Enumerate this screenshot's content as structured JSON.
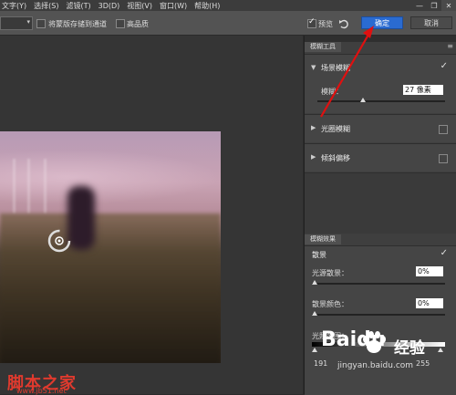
{
  "menu": {
    "items": [
      "文字(Y)",
      "选择(S)",
      "滤镜(T)",
      "3D(D)",
      "视图(V)",
      "窗口(W)",
      "帮助(H)"
    ]
  },
  "window": {
    "minimize": "—",
    "restore": "❐",
    "close": "✕"
  },
  "options": {
    "select_value": "",
    "save_mask_label": "将蒙版存储到通道",
    "high_quality_label": "高品质",
    "preview_label": "预览",
    "preview_checked": true,
    "ok_label": "确定",
    "cancel_label": "取消"
  },
  "panel": {
    "tab_label": "模糊工具",
    "field_blur": {
      "title": "场景模糊",
      "checked": true,
      "blur_label": "模糊：",
      "blur_value": "27 像素"
    },
    "iris_blur": {
      "title": "光圈模糊",
      "checked": false
    },
    "tilt_shift": {
      "title": "倾斜偏移",
      "checked": false
    },
    "effects_tab_label": "模糊效果",
    "bokeh": {
      "title": "散景",
      "checked": true,
      "light_bokeh_label": "光源散景：",
      "light_bokeh_value": "0%",
      "bokeh_color_label": "散景颜色：",
      "bokeh_color_value": "0%",
      "light_range_label": "光照范围：",
      "range_low": "191",
      "range_high": "255"
    }
  },
  "watermarks": {
    "site_cn": "脚本之家",
    "site_url": "www.jb51.net",
    "baidu_logo": "Baidu",
    "baidu_cn": "经验",
    "baidu_url": "jingyan.baidu.com"
  },
  "colors": {
    "accent_button": "#2a6bd1",
    "arrow": "#e01010",
    "watermark_red": "#e03a2e"
  }
}
